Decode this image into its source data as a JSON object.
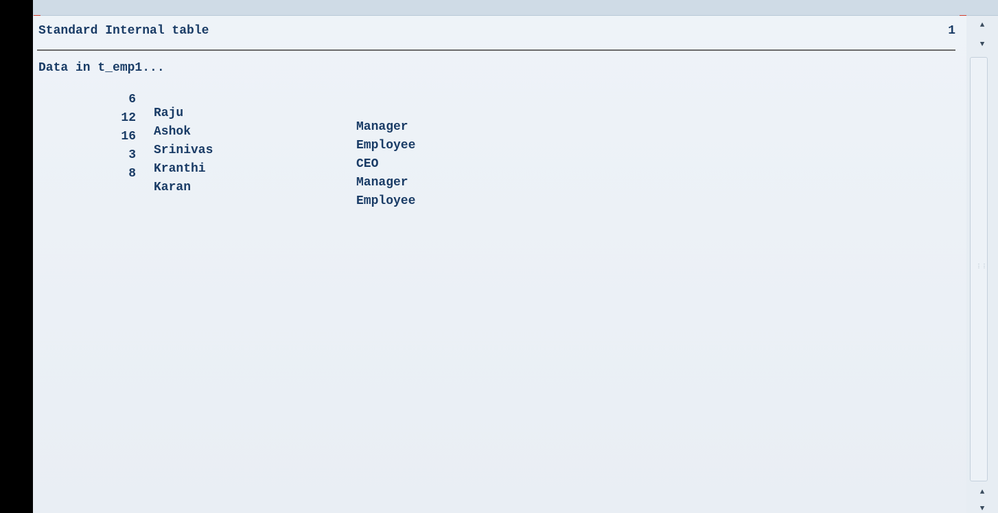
{
  "report": {
    "title": "Standard Internal table",
    "page_number": "1",
    "intro": "Data in t_emp1...",
    "rows": [
      {
        "id": "6",
        "name": "Raju",
        "role": "Manager"
      },
      {
        "id": "12",
        "name": "Ashok",
        "role": "Employee"
      },
      {
        "id": "16",
        "name": "Srinivas",
        "role": "CEO"
      },
      {
        "id": "3",
        "name": "Kranthi",
        "role": "Manager"
      },
      {
        "id": "8",
        "name": "Karan",
        "role": "Employee"
      }
    ]
  },
  "scrollbar": {
    "up_icon": "triangle-up",
    "down_icon": "triangle-down"
  },
  "colors": {
    "text": "#1a3c66",
    "background": "#eef2f6",
    "marker": "#d23c2c"
  }
}
